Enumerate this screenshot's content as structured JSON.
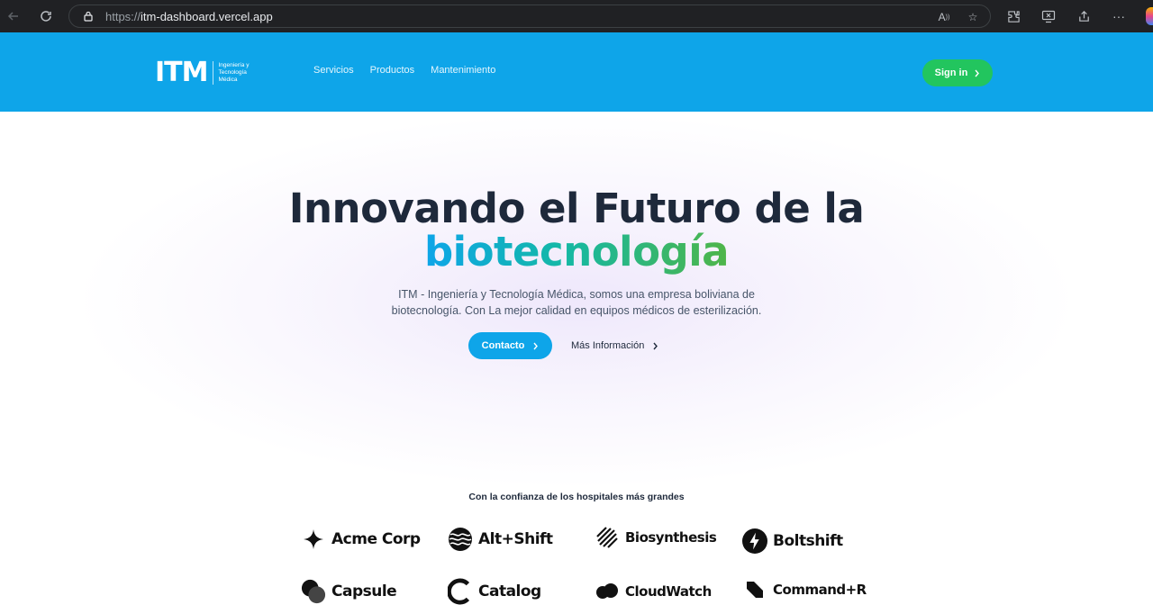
{
  "browser": {
    "url_scheme": "https://",
    "url_host": "itm-dashboard.vercel.app"
  },
  "header": {
    "logo_text": "ITM",
    "logo_subtitle": "Ingeniería y Tecnología Médica",
    "nav": [
      "Servicios",
      "Productos",
      "Mantenimiento"
    ],
    "signin_label": "Sign in",
    "color_bg": "#0ea5e9",
    "color_signin": "#22c55e"
  },
  "hero": {
    "title_line1": "Innovando el Futuro de la",
    "title_line2": "biotecnología",
    "description_line1": "ITM - Ingeniería y Tecnología Médica, somos una empresa boliviana de",
    "description_line2": "biotecnología. Con La mejor calidad en equipos médicos de esterilización.",
    "primary_cta": "Contacto",
    "secondary_cta": "Más Información"
  },
  "trusted": {
    "title": "Con la confianza de los hospitales más grandes",
    "logos": [
      {
        "name": "Acme Corp",
        "icon": "sparkle-icon"
      },
      {
        "name": "Alt+Shift",
        "icon": "waves-icon"
      },
      {
        "name": "Biosynthesis",
        "icon": "stripes-icon"
      },
      {
        "name": "Boltshift",
        "icon": "bolt-icon"
      },
      {
        "name": "Capsule",
        "icon": "capsule-icon"
      },
      {
        "name": "Catalog",
        "icon": "catalog-icon"
      },
      {
        "name": "CloudWatch",
        "icon": "cloud-icon"
      },
      {
        "name": "Command+R",
        "icon": "command-icon"
      }
    ]
  }
}
